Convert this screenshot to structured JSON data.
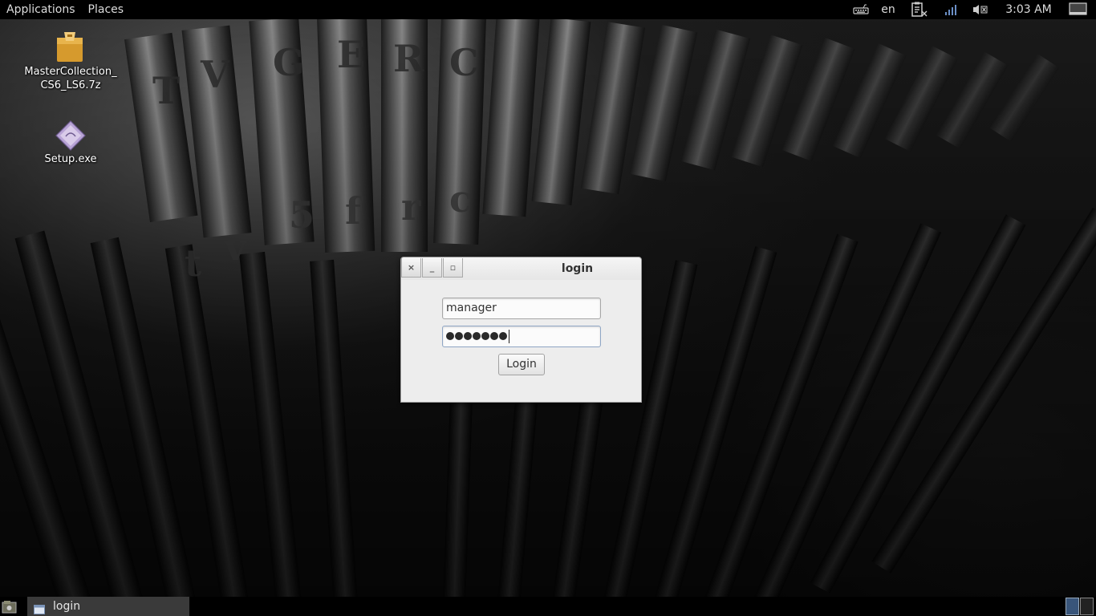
{
  "top_panel": {
    "menus": [
      "Applications",
      "Places"
    ],
    "keyboard_layout": "en",
    "clock": "3:03 AM",
    "icons": [
      "keyboard-icon",
      "clipboard-icon",
      "network-signal-icon",
      "volume-muted-icon",
      "window-list-icon"
    ]
  },
  "desktop": {
    "icons": [
      {
        "label": "MasterCollection_\nCS6_LS6.7z",
        "icon": "archive-icon"
      },
      {
        "label": "Setup.exe",
        "icon": "wine-executable-icon"
      }
    ]
  },
  "login_window": {
    "title": "login",
    "buttons": {
      "close": "×",
      "minimize": "_",
      "maximize": "▫"
    },
    "username": "manager",
    "password_mask_count": 7,
    "login_label": "Login"
  },
  "bottom_panel": {
    "tasks": [
      {
        "label": "login",
        "icon": "window-icon"
      }
    ],
    "workspaces": 2
  },
  "colors": {
    "panel": "#000000",
    "dialog": "#ededed",
    "active_task": "#3a3a3a",
    "active_workspace": "#39557a"
  }
}
